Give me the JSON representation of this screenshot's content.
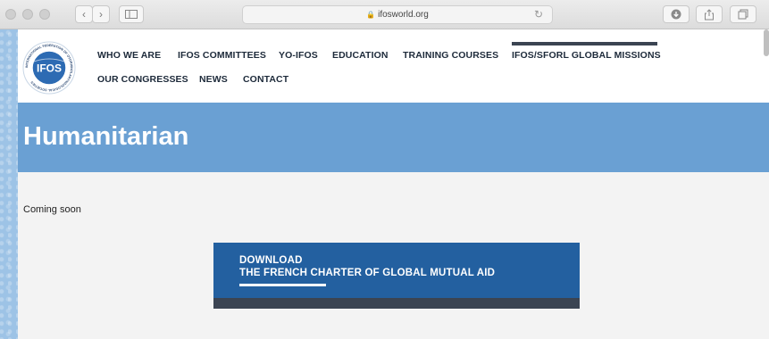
{
  "browser": {
    "url": "ifosworld.org",
    "lock_icon": "lock-icon",
    "reload_icon": "reload-icon"
  },
  "nav": {
    "row1": [
      "WHO WE ARE",
      "IFOS COMMITTEES",
      "YO-IFOS",
      "EDUCATION",
      "TRAINING COURSES",
      "IFOS/SFORL GLOBAL MISSIONS"
    ],
    "row2": [
      "OUR CONGRESSES",
      "NEWS",
      "CONTACT"
    ],
    "active": "IFOS/SFORL GLOBAL MISSIONS"
  },
  "logo": {
    "text": "IFOS",
    "ring_text": "INTERNATIONAL FEDERATION OF OTORHINOLARYNGOLOGICAL SOCIETIES"
  },
  "hero": {
    "title": "Humanitarian"
  },
  "content": {
    "coming_soon": "Coming soon"
  },
  "download": {
    "line1": "DOWNLOAD",
    "line2": "THE FRENCH CHARTER OF GLOBAL MUTUAL AID"
  },
  "colors": {
    "hero": "#6aa0d3",
    "download_bg": "#2360a0",
    "dark_bar": "#3b4452"
  }
}
